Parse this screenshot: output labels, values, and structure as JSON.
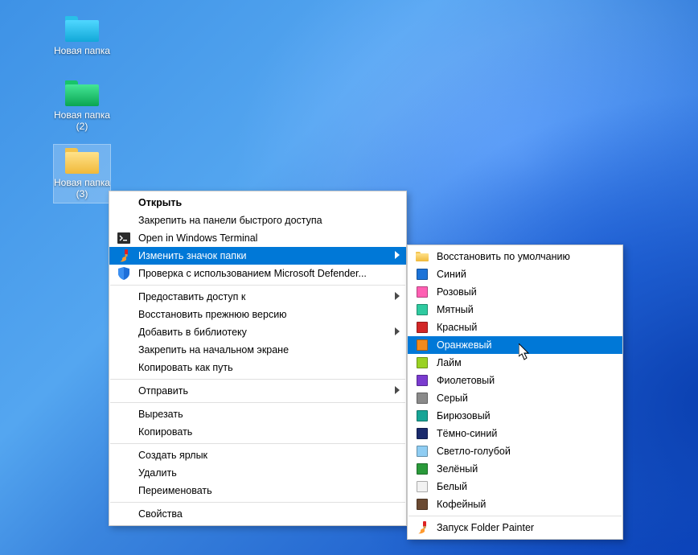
{
  "desktop_icons": [
    {
      "label": "Новая папка",
      "color": "blue",
      "selected": false
    },
    {
      "label": "Новая папка (2)",
      "color": "green",
      "selected": false
    },
    {
      "label": "Новая папка (3)",
      "color": "yellow",
      "selected": true
    }
  ],
  "context_menu": {
    "items": [
      {
        "label": "Открыть",
        "bold": true
      },
      {
        "label": "Закрепить на панели быстрого доступа"
      },
      {
        "label": "Open in Windows Terminal",
        "icon": "terminal"
      },
      {
        "label": "Изменить значок папки",
        "icon": "painter",
        "arrow": true,
        "selected": true
      },
      {
        "label": "Проверка с использованием Microsoft Defender...",
        "icon": "shield"
      },
      {
        "sep": true
      },
      {
        "label": "Предоставить доступ к",
        "arrow": true
      },
      {
        "label": "Восстановить прежнюю версию"
      },
      {
        "label": "Добавить в библиотеку",
        "arrow": true
      },
      {
        "label": "Закрепить на начальном экране"
      },
      {
        "label": "Копировать как путь"
      },
      {
        "sep": true
      },
      {
        "label": "Отправить",
        "arrow": true
      },
      {
        "sep": true
      },
      {
        "label": "Вырезать"
      },
      {
        "label": "Копировать"
      },
      {
        "sep": true
      },
      {
        "label": "Создать ярлык"
      },
      {
        "label": "Удалить"
      },
      {
        "label": "Переименовать"
      },
      {
        "sep": true
      },
      {
        "label": "Свойства"
      }
    ]
  },
  "submenu": {
    "items": [
      {
        "label": "Восстановить по умолчанию",
        "icon": "default-folder"
      },
      {
        "label": "Синий",
        "swatch": "#1c73d8"
      },
      {
        "label": "Розовый",
        "swatch": "#ff5fb3"
      },
      {
        "label": "Мятный",
        "swatch": "#2fcaa0"
      },
      {
        "label": "Красный",
        "swatch": "#d22626"
      },
      {
        "label": "Оранжевый",
        "swatch": "#f28a1c",
        "selected": true
      },
      {
        "label": "Лайм",
        "swatch": "#9ad223"
      },
      {
        "label": "Фиолетовый",
        "swatch": "#7a3bcf"
      },
      {
        "label": "Серый",
        "swatch": "#8a8a8a"
      },
      {
        "label": "Бирюзовый",
        "swatch": "#17a596"
      },
      {
        "label": "Тёмно-синий",
        "swatch": "#1a2a6c"
      },
      {
        "label": "Светло-голубой",
        "swatch": "#8fcdf3"
      },
      {
        "label": "Зелёный",
        "swatch": "#2a9a3a"
      },
      {
        "label": "Белый",
        "swatch": "#f2f2f2"
      },
      {
        "label": "Кофейный",
        "swatch": "#6a4a32"
      },
      {
        "sep": true
      },
      {
        "label": "Запуск Folder Painter",
        "icon": "painter"
      }
    ]
  }
}
